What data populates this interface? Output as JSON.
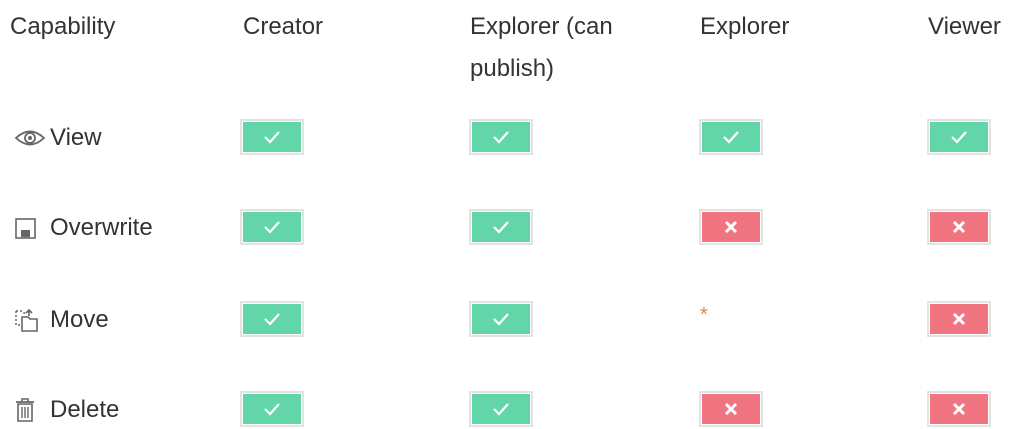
{
  "colors": {
    "yes_fill": "#62d6a8",
    "no_fill": "#f07580",
    "badge_border": "#e3e3e3",
    "note_asterisk": "#e8843c",
    "text": "#333333"
  },
  "table": {
    "headers": [
      "Capability",
      "Creator",
      "Explorer (can\npublish)",
      "Explorer",
      "Viewer"
    ],
    "rows": [
      {
        "label": "View",
        "icon": "eye-icon",
        "cells": [
          "yes",
          "yes",
          "yes",
          "yes"
        ]
      },
      {
        "label": "Overwrite",
        "icon": "save-disk-icon",
        "cells": [
          "yes",
          "yes",
          "no",
          "no"
        ]
      },
      {
        "label": "Move",
        "icon": "move-folder-icon",
        "cells": [
          "yes",
          "yes",
          "note",
          "no"
        ]
      },
      {
        "label": "Delete",
        "icon": "trash-icon",
        "cells": [
          "yes",
          "yes",
          "no",
          "no"
        ]
      }
    ],
    "note_symbol": "*"
  }
}
